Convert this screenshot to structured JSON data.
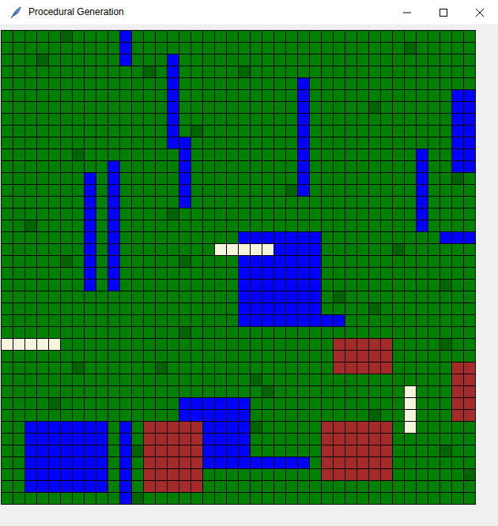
{
  "window": {
    "title": "Procedural Generation"
  },
  "tiles": [
    {
      "symbol": "G",
      "kind": "grass",
      "color": "#008000"
    },
    {
      "symbol": "D",
      "kind": "forest",
      "color": "#006400"
    },
    {
      "symbol": "W",
      "kind": "water",
      "color": "#0000ff"
    },
    {
      "symbol": "M",
      "kind": "mountain",
      "color": "#a52a2a"
    },
    {
      "symbol": "S",
      "kind": "sand",
      "color": "#f5f5dc"
    }
  ],
  "map": [
    "GGGGGDGGGGWGGGGGGGGGGGGGGGGGGGGGGGGGGGGG",
    "GGGGGGGGGGWGGGGGGGGGGGGGGGGGGGGGGGDGGG",
    "GGGDGGGGGGWGGGWGGGGGGGGGGGGGGGGGGGGGGGGG",
    "GGGGGGGGGGGGDGWGGGGGDGGGGGGGGGGGGGGGGGGG",
    "GGGGGGGGGGGGGGWGGGGGGGGGGWGGGGGGGGGGGGGG",
    "GGGGGGGGGGGGGGWGGGGGGGGGGWGGGGGGGGGGGGWW",
    "GGGGGGGGGGGGGGWGGGGGGGGGGWGGGGGDGGGGGGWW",
    "GGGGGGGGGGGGGGWGGGGGGGGGGWGGGGGGGGGGGGWW",
    "GGGGGGGGGGGGGGWGDGGGGGGGGWGGGGGGGGGGGGWW",
    "GGGGGGGGGGGGGGWWGGGGGGGGGWGGGGGGGGGGGGWW",
    "GGGGGGDGGGGGGGGWGGGGGGGGGWGGGGGGGGGWGGWW",
    "GGGGGGGGGWGGGGGWGGGGGGGGGWGGGGGGGGGWGGWW",
    "GGGGGGGWGWGGGGGWGGGGGGGGGWGGGGGGGGGWGGDG",
    "GGGGGGGWGWGGGGGWGGGGGGGGDWGGGGGGGGGWGGGG",
    "GGGGGGGWGWGGGGGWGGGGGGGGGGGGGGGGGGGWGGGG",
    "GGGGGGGWGWGGGGDGGGGGGGGGGGGGGGGGGGGWGGGG",
    "GGDGGGGWGWGGGGGGGGGGGGGGGGGGGGGGGGGWGGGG",
    "GGGGGGGWGWGGGGGGGGGGWWWWWWWGGGGGGGGGGWWW",
    "GGGGGGGWGWGGGGGGGGSSSSSWWWWGGGGGGDGGGGGG",
    "GGGGGDGWGWGGGGGDGGGGWWWWWWWGGGGGGGGGGGGG",
    "GGGGGGGWGWGGGGGGGGGGWWWWWWWGGGGGGGGGGGGG",
    "GGGGGGGWGWGGGGGGGGGGWWWWWWWGGGGGGGGGGDGG",
    "GGGGGGGGGGGGGGGGGGGGWWWWWWWGDGGGGGGGGGGG",
    "GGGGGGGGGGGGGGGGGGGGWWWWWWWGGGGDGGGGGGGG",
    "GGGGGGGGGGGGGGGGGGGGWWWWWWWWWGGGGGGGGGGG",
    "GGGGGGGGGGGGGGGDGGGGGGGGGGGGGGGGGGGGGGGG",
    "SSSSSGGGGGGGGGGGGGGGGGGGGGGGMMMMMGGGGDGG",
    "GGGGGGGGGGGGGGGGGGGGGGGGGGGGMMMMMGGGGGGG",
    "GGGGGGDGGGGGGDGGGGGGGGGGGGGGMMMMMGGGGGMM",
    "GGGGGGGGGGGGGGGGGGGGGDGGGGGGGGGGGGGGGGMM",
    "GGGGGGGGGGGGGGGGGGGGGGDGGGGGGGGGGGSGGGMM",
    "GGGGDGGGGGGGGGGWWWWWWGGGGGGGGGGGGGSGGGMM",
    "GGGGGGGGGGGGGGGWWWWWWGGGGGGGGGGDGGSGGGMM",
    "GGWWWWWWWGWGMMMMMWWWWDGGGGGMMMMMMGSGGGGG",
    "GGWWWWWWWGWGMMMMMWWWWGGGGGGMMMMMMGGGGGGG",
    "GGWWWWWWWGWDMMMMMWWWWGGGGGGMMMMMMGGGGDGG",
    "GGWWWWWWWGWGMMMMMWWWWWWWWWGMMMMMMGGGGGGG",
    "GGWWWWWWWGWGMMMMMGGGGGGGGGGMMMMMMGGGGGGD",
    "GGWWWWWWWGWGMMMMMGGGGGGGGGGGGGGGGGGGGGGG",
    "GGGGGGGGGGWDGGGGGGGGGGGGGGGGGGGGGGGGGGGG"
  ]
}
